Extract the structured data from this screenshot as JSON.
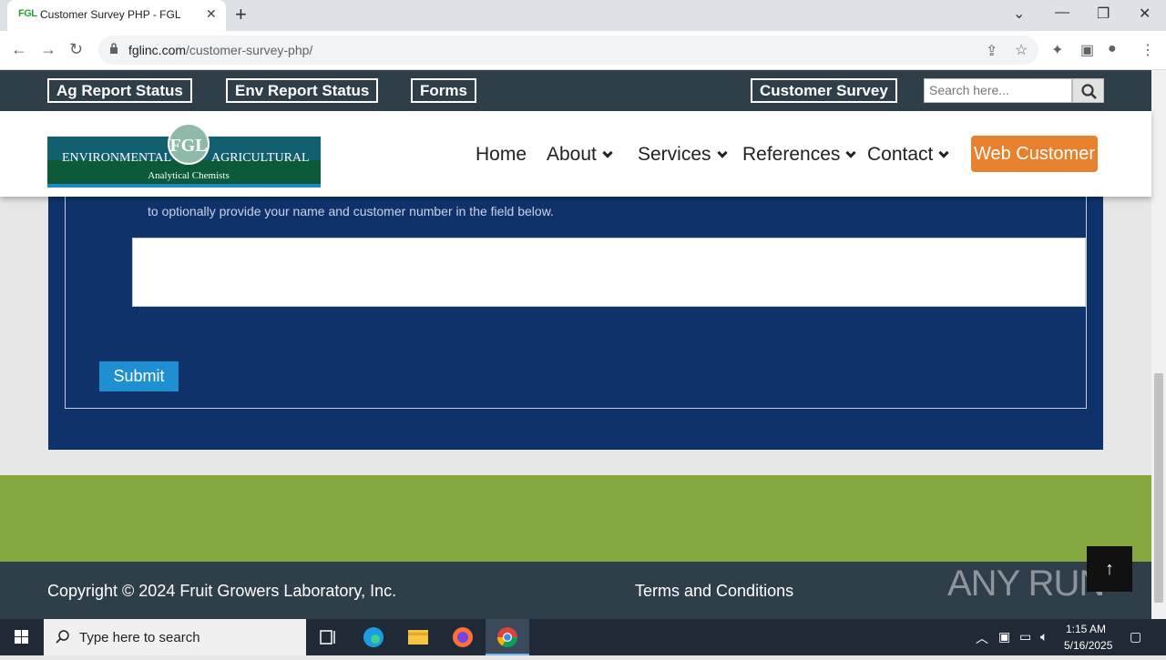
{
  "browser": {
    "tab_title": "Customer Survey PHP - FGL",
    "tab_favicon": "FGL",
    "url_domain": "fglinc.com",
    "url_path": "/customer-survey-php/"
  },
  "topbar": {
    "buttons": [
      "Ag Report Status",
      "Env Report Status",
      "Forms",
      "Customer Survey"
    ],
    "search_placeholder": "Search here..."
  },
  "header": {
    "logo_badge": "FGL",
    "logo_left": "ENVIRONMENTAL",
    "logo_right": "AGRICULTURAL",
    "logo_sub": "Analytical Chemists",
    "nav": [
      "Home",
      "About",
      "Services",
      "References",
      "Contact"
    ],
    "cta": "Web Customer"
  },
  "form": {
    "description": "to optionally provide your name and customer number in the field below.",
    "textarea_value": "",
    "submit_label": "Submit"
  },
  "footer": {
    "copyright": "Copyright © 2024 Fruit Growers Laboratory, Inc.",
    "terms": "Terms and Conditions",
    "watermark": "ANY RUN"
  },
  "taskbar": {
    "search_placeholder": "Type here to search",
    "time": "1:15 AM",
    "date": "5/16/2025"
  },
  "colors": {
    "topbar": "#2f3f4a",
    "content_bg": "#0f326b",
    "submit": "#1e8fd1",
    "cta": "#e8812d",
    "green_band": "#85a83f"
  }
}
